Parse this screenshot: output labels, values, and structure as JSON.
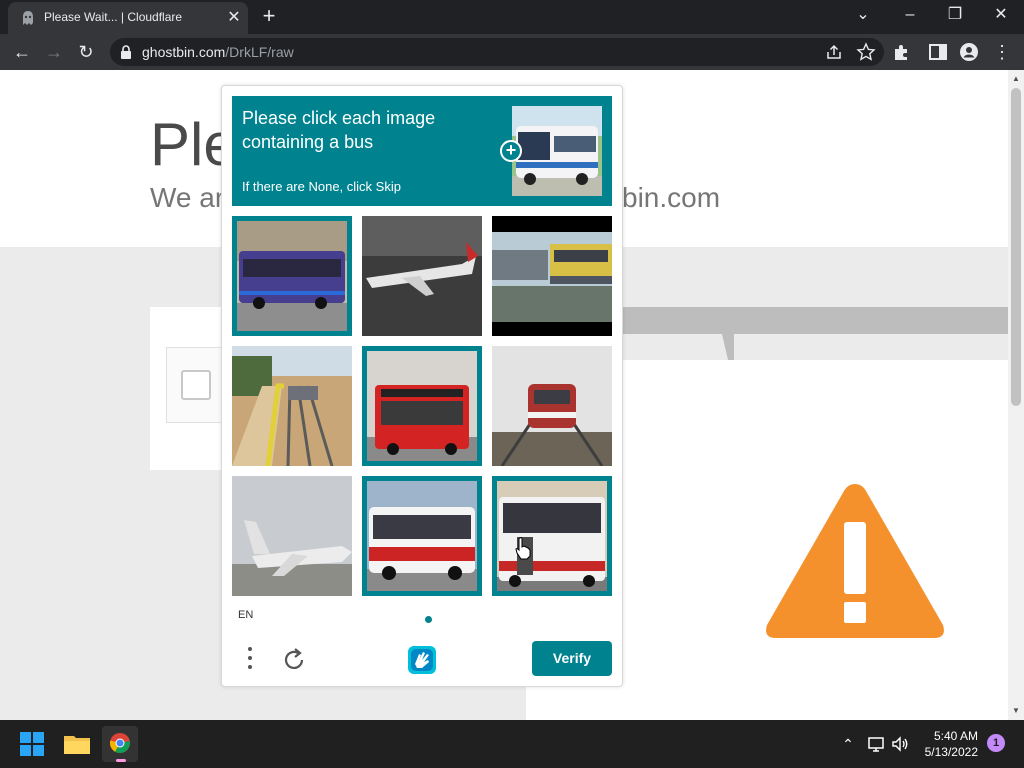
{
  "browser": {
    "tab_title": "Please Wait... | Cloudflare",
    "url_domain": "ghostbin.com",
    "url_path": "/DrkLF/raw"
  },
  "background_page": {
    "heading_partial": "Ple",
    "subtitle_left": "We ar",
    "subtitle_right": "bin.com"
  },
  "captcha": {
    "prompt_title": "Please click each image containing a bus",
    "prompt_subtitle": "If there are None, click Skip",
    "language": "EN",
    "verify_label": "Verify",
    "tiles": [
      {
        "subject": "blue bus",
        "selected": true
      },
      {
        "subject": "airplane on runway",
        "selected": false
      },
      {
        "subject": "train at station",
        "selected": false
      },
      {
        "subject": "train platform",
        "selected": false
      },
      {
        "subject": "red bus",
        "selected": true
      },
      {
        "subject": "train on tracks",
        "selected": false
      },
      {
        "subject": "private jet",
        "selected": false
      },
      {
        "subject": "white red bus",
        "selected": true
      },
      {
        "subject": "articulated bus",
        "selected": true
      }
    ]
  },
  "taskbar": {
    "time": "5:40 AM",
    "date": "5/13/2022",
    "notification_count": "1"
  },
  "colors": {
    "captcha_accent": "#00838f",
    "warning_orange": "#f5912d"
  }
}
